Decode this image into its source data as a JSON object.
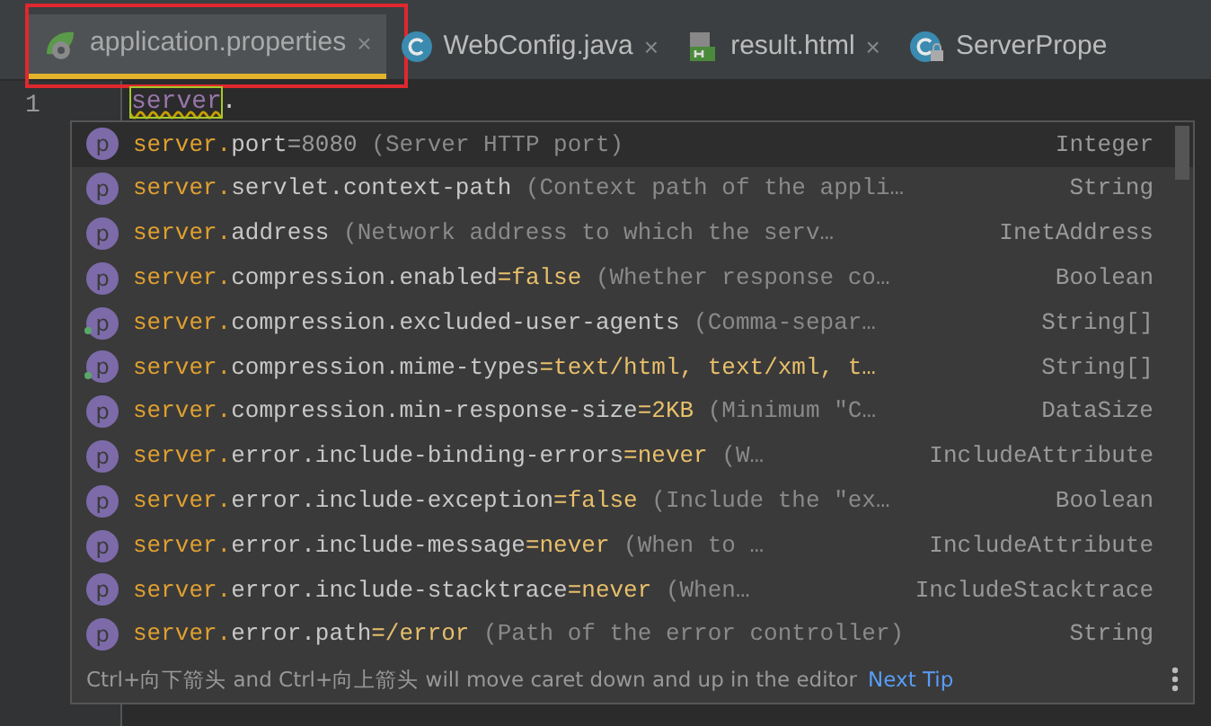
{
  "tabs": [
    {
      "label": "application.properties",
      "kind": "properties",
      "close": "×",
      "selected": true,
      "highlighted": true
    },
    {
      "label": "WebConfig.java",
      "kind": "class",
      "close": "×",
      "selected": false,
      "highlighted": false
    },
    {
      "label": "result.html",
      "kind": "html",
      "close": "×",
      "selected": false,
      "highlighted": false
    },
    {
      "label": "ServerPrope",
      "kind": "locked-class",
      "selected": false,
      "highlighted": false
    }
  ],
  "editor": {
    "line_number": "1",
    "typed": "server",
    "rest": "."
  },
  "completion": {
    "items": [
      {
        "icon": "p",
        "prefix": "server.",
        "key": "port",
        "value": "=8080",
        "description": " (Server HTTP port)",
        "type": "Integer",
        "selected": true,
        "marked": false
      },
      {
        "icon": "p",
        "prefix": "server.",
        "key": "servlet.context-path",
        "description": " (Context path of the appli…",
        "type": "String",
        "selected": false,
        "marked": false
      },
      {
        "icon": "p",
        "prefix": "server.",
        "key": "address",
        "description": " (Network address to which the serv…",
        "type": "InetAddress",
        "selected": false,
        "marked": false
      },
      {
        "icon": "p",
        "prefix": "server.",
        "key": "compression.enabled",
        "value": "=false",
        "description": " (Whether response co…",
        "type": "Boolean",
        "selected": false,
        "marked": false
      },
      {
        "icon": "p",
        "prefix": "server.",
        "key": "compression.excluded-user-agents",
        "description": " (Comma-separ…",
        "type": "String[]",
        "selected": false,
        "marked": true
      },
      {
        "icon": "p",
        "prefix": "server.",
        "key": "compression.mime-types",
        "value": "=text/html, text/xml, t…",
        "type": "String[]",
        "selected": false,
        "marked": true
      },
      {
        "icon": "p",
        "prefix": "server.",
        "key": "compression.min-response-size",
        "value": "=2KB",
        "description": " (Minimum \"C…",
        "type": "DataSize",
        "selected": false,
        "marked": false
      },
      {
        "icon": "p",
        "prefix": "server.",
        "key": "error.include-binding-errors",
        "value": "=never",
        "description": " (W…",
        "type": "IncludeAttribute",
        "selected": false,
        "marked": false
      },
      {
        "icon": "p",
        "prefix": "server.",
        "key": "error.include-exception",
        "value": "=false",
        "description": " (Include the \"ex…",
        "type": "Boolean",
        "selected": false,
        "marked": false
      },
      {
        "icon": "p",
        "prefix": "server.",
        "key": "error.include-message",
        "value": "=never",
        "description": " (When to …",
        "type": "IncludeAttribute",
        "selected": false,
        "marked": false
      },
      {
        "icon": "p",
        "prefix": "server.",
        "key": "error.include-stacktrace",
        "value": "=never",
        "description": " (When…",
        "type": "IncludeStacktrace",
        "selected": false,
        "marked": false
      },
      {
        "icon": "p",
        "prefix": "server.",
        "key": "error.path",
        "value": "=/error",
        "description": " (Path of the error controller)",
        "type": "String",
        "selected": false,
        "marked": false
      }
    ],
    "tip": "Ctrl+向下箭头 and Ctrl+向上箭头 will move caret down and up in the editor",
    "tip_link": "Next Tip"
  }
}
